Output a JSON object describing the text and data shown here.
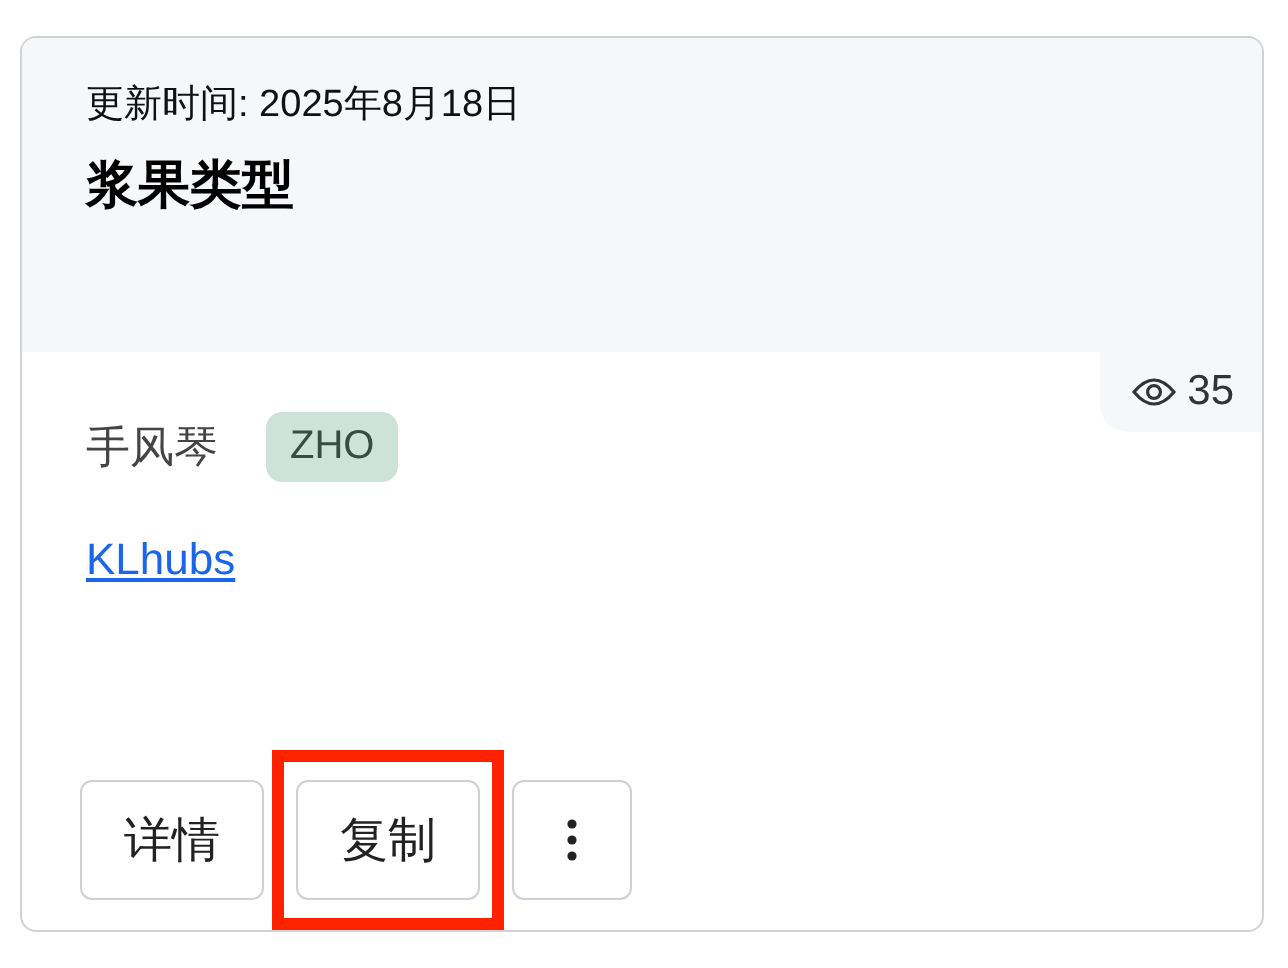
{
  "card": {
    "updated": "更新时间: 2025年8月18日",
    "title": "浆果类型",
    "views": "35",
    "author": "手风琴",
    "tag": "ZHO",
    "link": "KLhubs"
  },
  "buttons": [
    {
      "kind": "text",
      "label": "详情",
      "highlighted": false
    },
    {
      "kind": "text",
      "label": "复制",
      "highlighted": true
    },
    {
      "kind": "more",
      "highlighted": false
    }
  ]
}
